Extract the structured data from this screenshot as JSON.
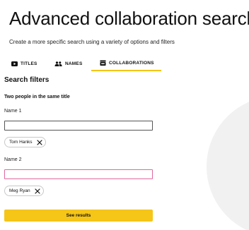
{
  "header": {
    "title": "Advanced collaboration search",
    "subtitle": "Create a more specific search using a variety of options and filters"
  },
  "tabs": [
    {
      "label": "TITLES",
      "icon": "video-icon",
      "active": false
    },
    {
      "label": "NAMES",
      "icon": "people-icon",
      "active": false
    },
    {
      "label": "COLLABORATIONS",
      "icon": "collaboration-icon",
      "active": true
    }
  ],
  "filters": {
    "section_title": "Search filters",
    "group_title": "Two people in the same title",
    "name1": {
      "label": "Name 1",
      "value": "",
      "chip": "Tom Hanks"
    },
    "name2": {
      "label": "Name 2",
      "value": "",
      "chip": "Meg Ryan"
    },
    "submit_label": "See results"
  },
  "colors": {
    "accent": "#f5c518",
    "focus_border": "#e0679e",
    "text": "#111111"
  }
}
